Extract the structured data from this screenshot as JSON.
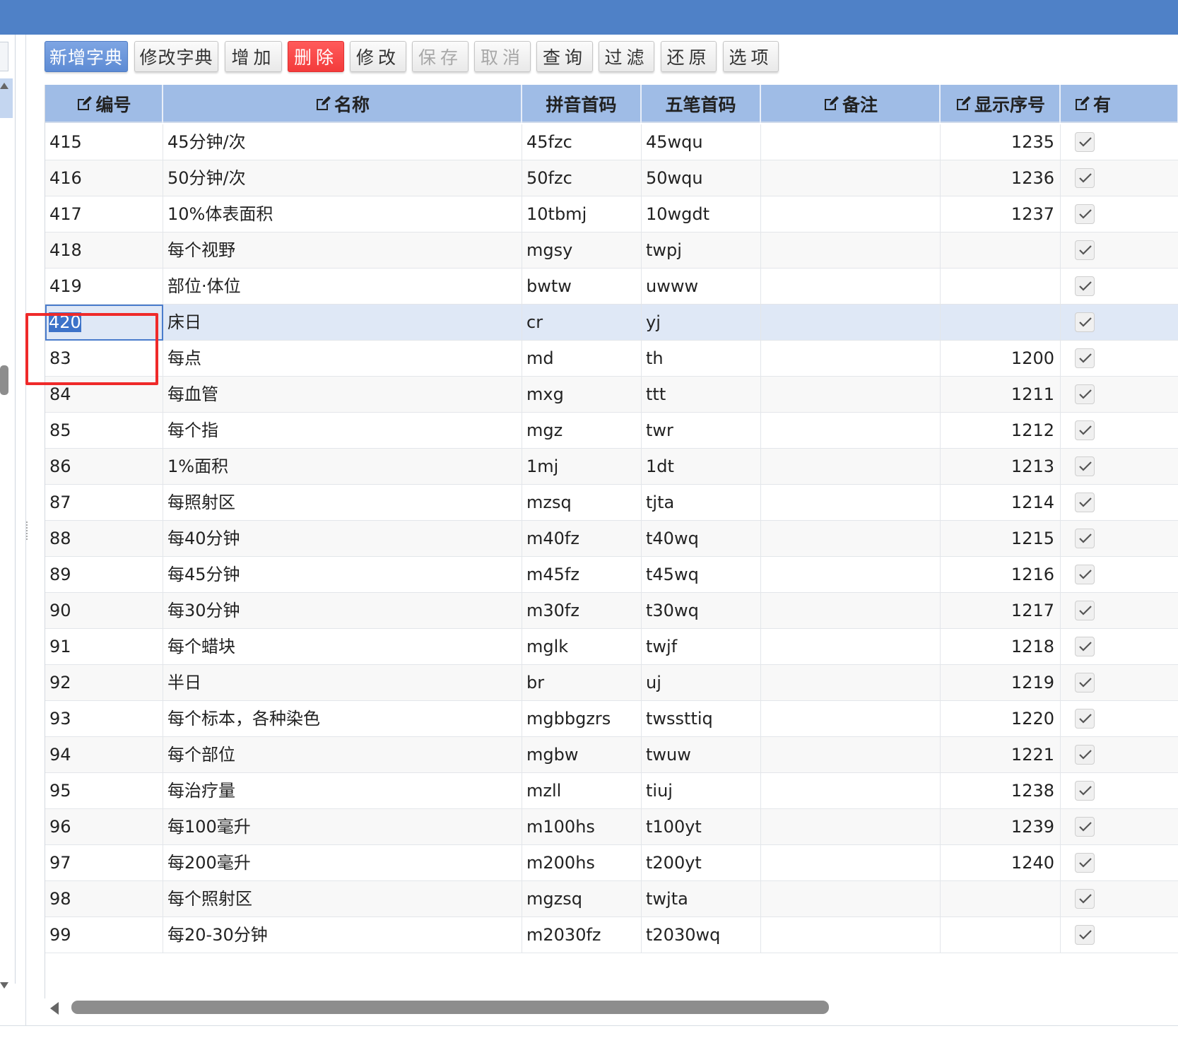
{
  "toolbar": {
    "buttons": [
      {
        "label": "新增字典",
        "state": "primary"
      },
      {
        "label": "修改字典",
        "state": "normal"
      },
      {
        "label": "增加",
        "state": "normal"
      },
      {
        "label": "删除",
        "state": "danger"
      },
      {
        "label": "修改",
        "state": "normal"
      },
      {
        "label": "保存",
        "state": "disabled"
      },
      {
        "label": "取消",
        "state": "disabled"
      },
      {
        "label": "查询",
        "state": "normal"
      },
      {
        "label": "过滤",
        "state": "normal"
      },
      {
        "label": "还原",
        "state": "normal"
      },
      {
        "label": "选项",
        "state": "normal"
      }
    ]
  },
  "grid": {
    "columns": [
      {
        "label": "编号",
        "editable": true
      },
      {
        "label": "名称",
        "editable": true
      },
      {
        "label": "拼音首码",
        "editable": false
      },
      {
        "label": "五笔首码",
        "editable": false
      },
      {
        "label": "备注",
        "editable": true
      },
      {
        "label": "显示序号",
        "editable": true
      },
      {
        "label": "有",
        "editable": true
      }
    ],
    "selected_row_index": 5,
    "rows": [
      {
        "id": "415",
        "name": "45分钟/次",
        "pinyin": "45fzc",
        "wubi": "45wqu",
        "note": "",
        "order": "1235",
        "valid": true
      },
      {
        "id": "416",
        "name": "50分钟/次",
        "pinyin": "50fzc",
        "wubi": "50wqu",
        "note": "",
        "order": "1236",
        "valid": true
      },
      {
        "id": "417",
        "name": "10%体表面积",
        "pinyin": "10tbmj",
        "wubi": "10wgdt",
        "note": "",
        "order": "1237",
        "valid": true
      },
      {
        "id": "418",
        "name": "每个视野",
        "pinyin": "mgsy",
        "wubi": "twpj",
        "note": "",
        "order": "",
        "valid": true
      },
      {
        "id": "419",
        "name": "部位·体位",
        "pinyin": "bwtw",
        "wubi": "uwww",
        "note": "",
        "order": "",
        "valid": true
      },
      {
        "id": "420",
        "name": "床日",
        "pinyin": "cr",
        "wubi": "yj",
        "note": "",
        "order": "",
        "valid": true
      },
      {
        "id": "83",
        "name": "每点",
        "pinyin": "md",
        "wubi": "th",
        "note": "",
        "order": "1200",
        "valid": true
      },
      {
        "id": "84",
        "name": "每血管",
        "pinyin": "mxg",
        "wubi": "ttt",
        "note": "",
        "order": "1211",
        "valid": true
      },
      {
        "id": "85",
        "name": "每个指",
        "pinyin": "mgz",
        "wubi": "twr",
        "note": "",
        "order": "1212",
        "valid": true
      },
      {
        "id": "86",
        "name": "1%面积",
        "pinyin": "1mj",
        "wubi": "1dt",
        "note": "",
        "order": "1213",
        "valid": true
      },
      {
        "id": "87",
        "name": "每照射区",
        "pinyin": "mzsq",
        "wubi": "tjta",
        "note": "",
        "order": "1214",
        "valid": true
      },
      {
        "id": "88",
        "name": "每40分钟",
        "pinyin": "m40fz",
        "wubi": "t40wq",
        "note": "",
        "order": "1215",
        "valid": true
      },
      {
        "id": "89",
        "name": "每45分钟",
        "pinyin": "m45fz",
        "wubi": "t45wq",
        "note": "",
        "order": "1216",
        "valid": true
      },
      {
        "id": "90",
        "name": "每30分钟",
        "pinyin": "m30fz",
        "wubi": "t30wq",
        "note": "",
        "order": "1217",
        "valid": true
      },
      {
        "id": "91",
        "name": "每个蜡块",
        "pinyin": "mglk",
        "wubi": "twjf",
        "note": "",
        "order": "1218",
        "valid": true
      },
      {
        "id": "92",
        "name": "半日",
        "pinyin": "br",
        "wubi": "uj",
        "note": "",
        "order": "1219",
        "valid": true
      },
      {
        "id": "93",
        "name": "每个标本，各种染色",
        "pinyin": "mgbbgzrs",
        "wubi": "twssttiq",
        "note": "",
        "order": "1220",
        "valid": true
      },
      {
        "id": "94",
        "name": "每个部位",
        "pinyin": "mgbw",
        "wubi": "twuw",
        "note": "",
        "order": "1221",
        "valid": true
      },
      {
        "id": "95",
        "name": "每治疗量",
        "pinyin": "mzll",
        "wubi": "tiuj",
        "note": "",
        "order": "1238",
        "valid": true
      },
      {
        "id": "96",
        "name": "每100毫升",
        "pinyin": "m100hs",
        "wubi": "t100yt",
        "note": "",
        "order": "1239",
        "valid": true
      },
      {
        "id": "97",
        "name": "每200毫升",
        "pinyin": "m200hs",
        "wubi": "t200yt",
        "note": "",
        "order": "1240",
        "valid": true
      },
      {
        "id": "98",
        "name": "每个照射区",
        "pinyin": "mgzsq",
        "wubi": "twjta",
        "note": "",
        "order": "",
        "valid": true
      },
      {
        "id": "99",
        "name": "每20-30分钟",
        "pinyin": "m2030fz",
        "wubi": "t2030wq",
        "note": "",
        "order": "",
        "valid": true
      }
    ]
  },
  "colors": {
    "topbar": "#4f81c7",
    "header": "#9fbce6",
    "selected_row": "#dfe8f6",
    "delete_button": "#f33b3b",
    "annotation": "#ef2a2a"
  },
  "icons": {
    "header_edit": "edit-icon",
    "row_check": "check-icon"
  }
}
